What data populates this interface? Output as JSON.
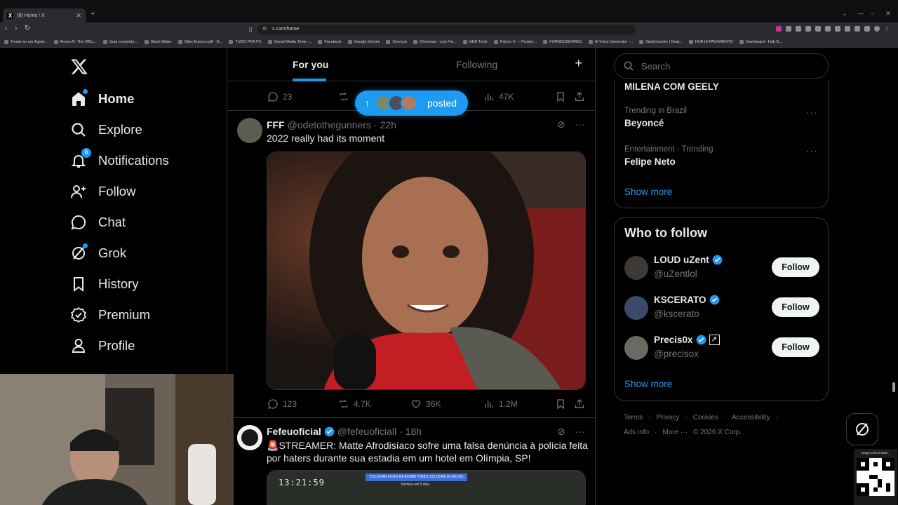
{
  "browser": {
    "tab_title": "(8) Home / X",
    "url": "x.com/home",
    "bookmarks": [
      "Tornar-se um Agent...",
      "Arena AI: The Offici...",
      "Guia completo:...",
      "Black Water",
      "Sites Eussos.pdf - G...",
      "TUDO PRA PC",
      "Social Media Tools -...",
      "Facebook",
      "Google Gemini",
      "Serviços",
      "Checkout - Luis Fer...",
      "GBR Tools",
      "Falcon X — Projeto...",
      "FORNECEDORES",
      "AI Voice Generator -...",
      "StatsCounter | Deat...",
      "HUB IA PAGAMENTO",
      "Dashboard - Hub D..."
    ]
  },
  "nav": {
    "items": [
      {
        "label": "Home",
        "icon": "home-icon"
      },
      {
        "label": "Explore",
        "icon": "search-icon"
      },
      {
        "label": "Notifications",
        "icon": "bell-icon",
        "badge": "8"
      },
      {
        "label": "Follow",
        "icon": "add-person-icon"
      },
      {
        "label": "Chat",
        "icon": "chat-bubble-icon"
      },
      {
        "label": "Grok",
        "icon": "grok-icon"
      },
      {
        "label": "History",
        "icon": "bookmark-icon"
      },
      {
        "label": "Premium",
        "icon": "verified-badge-icon"
      },
      {
        "label": "Profile",
        "icon": "person-icon"
      }
    ]
  },
  "feed": {
    "tabs": [
      "For you",
      "Following"
    ],
    "pill_text": "posted",
    "prev_tweet": {
      "replies": "23",
      "views": "47K"
    },
    "tweets": [
      {
        "name": "FFF",
        "handle": "@odetothegunners",
        "time": "22h",
        "text": "2022 really had its moment",
        "replies": "123",
        "retweets": "4.7K",
        "likes": "36K",
        "views": "1.2M"
      },
      {
        "name": "Fefeuoficial",
        "handle": "@fefeuoficiall",
        "time": "18h",
        "text_line1": "STREAMER: Matte Afrodisíaco sofre uma falsa denúncia à polícia feita",
        "text_line2": "por haters durante sua estadia em um hotel em Olímpia, SP!",
        "media_clock": "13:21:59",
        "media_banner": "COLOCAR FOGO NA KOMBI !! (R$ 2.221,01/R$ 30.000,00)",
        "media_sub": "Termina em 5 dias"
      }
    ]
  },
  "sidebar": {
    "search_placeholder": "Search",
    "trends": [
      {
        "context": "",
        "name": "MILENA COM GEELY"
      },
      {
        "context": "Trending in Brazil",
        "name": "Beyoncé"
      },
      {
        "context": "Entertainment · Trending",
        "name": "Felipe Neto"
      }
    ],
    "show_more": "Show more",
    "who_to_follow_title": "Who to follow",
    "who_to_follow": [
      {
        "name": "LOUD uZent",
        "handle": "@uZentlol",
        "button": "Follow"
      },
      {
        "name": "KSCERATO",
        "handle": "@kscerato",
        "button": "Follow"
      },
      {
        "name": "Precis0x",
        "handle": "@precisox",
        "button": "Follow"
      }
    ],
    "footer_row1": [
      "Terms",
      "Privacy",
      "Cookies",
      "Accessibility"
    ],
    "footer_row2": [
      "Ads info",
      "More ···",
      "© 2026 X Corp."
    ],
    "qr_caption": "pixgg.com/uJotape_"
  }
}
